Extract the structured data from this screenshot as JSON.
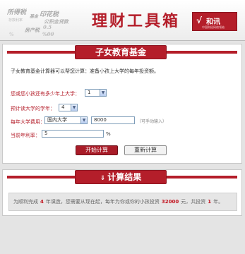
{
  "banner": {
    "watermarks": [
      "所得税",
      "存款利率",
      "基金",
      "印花税",
      "公积金贷款",
      "房产税",
      "0.5",
      "%",
      "%00"
    ],
    "title": "理财工具箱",
    "logo": {
      "mark": "√",
      "name": "和讯",
      "sub": "中国财经网络领袖"
    }
  },
  "calculator": {
    "tab": "子女教育基金",
    "intro": "子女教育基金计算器可以帮您计算：准备小孩上大学的每年投资额。",
    "years_label": "您或您小孩还有多少年上大学：",
    "years_value": "1",
    "duration_label": "预计读大学的学年：",
    "duration_value": "4",
    "cost_label": "每年大学费用：",
    "cost_type": "国内大学",
    "cost_value": "8000",
    "cost_hint": "（可手动输入）",
    "rate_label": "当前年利率：",
    "rate_value": "5",
    "rate_unit": "%",
    "start_button": "开始计算",
    "reset_button": "重新计算"
  },
  "result": {
    "tab": "计算结果",
    "tab_icon": "double-chevron-down-icon",
    "text_1": "为顺利完成",
    "years": "4",
    "text_2": "年课造，您需要从现在起，每年为你或你的小孩投资",
    "amount": "32000",
    "text_3": "元，共投资",
    "count": "1",
    "text_4": "年。"
  },
  "colors": {
    "brand": "#b41e2a",
    "highlight": "#c2121d"
  }
}
